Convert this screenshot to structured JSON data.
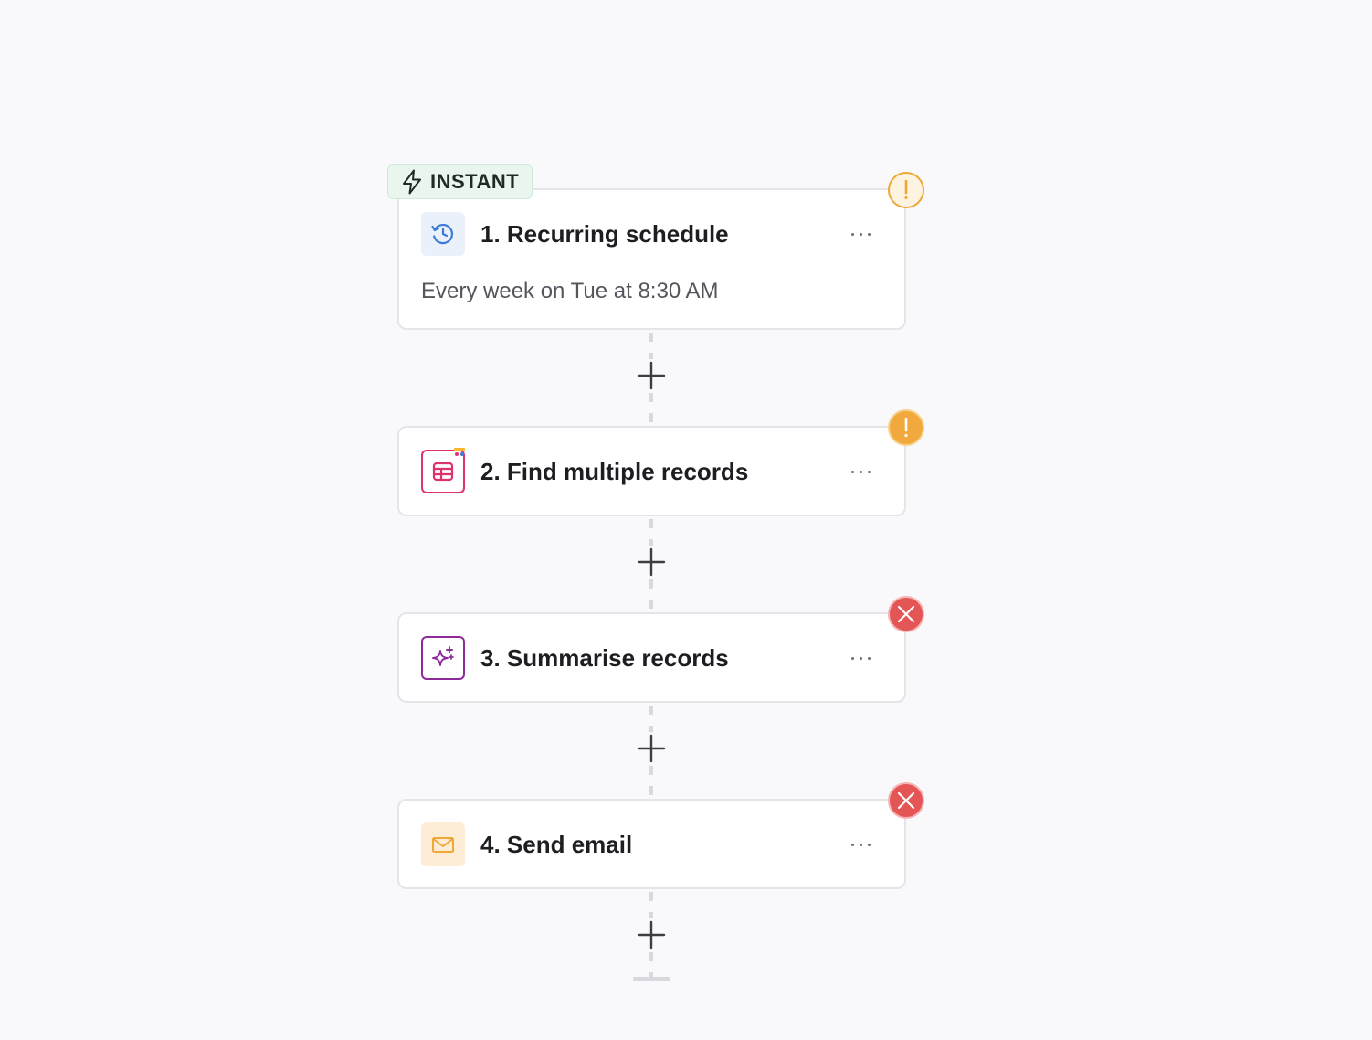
{
  "trigger_badge": {
    "label": "INSTANT",
    "icon": "lightning-icon",
    "color": "#e9f6ee"
  },
  "steps": [
    {
      "title": "1. Recurring schedule",
      "subtitle": "Every week on Tue at 8:30 AM",
      "icon": "clock-refresh-icon",
      "icon_bg": "#eaf1fb",
      "status": "warning",
      "more_label": "More options"
    },
    {
      "title": "2. Find multiple records",
      "icon": "table-icon",
      "icon_bg": "#ffffff",
      "status": "warning",
      "more_label": "More options"
    },
    {
      "title": "3. Summarise records",
      "icon": "sparkle-icon",
      "icon_bg": "#ffffff",
      "status": "error",
      "more_label": "More options"
    },
    {
      "title": "4. Send email",
      "icon": "envelope-icon",
      "icon_bg": "#fdecd6",
      "status": "error",
      "more_label": "More options"
    }
  ],
  "colors": {
    "warning": "#f0a736",
    "error": "#e45656",
    "background": "#f9f9fb",
    "card_border": "#e4e4e9"
  }
}
